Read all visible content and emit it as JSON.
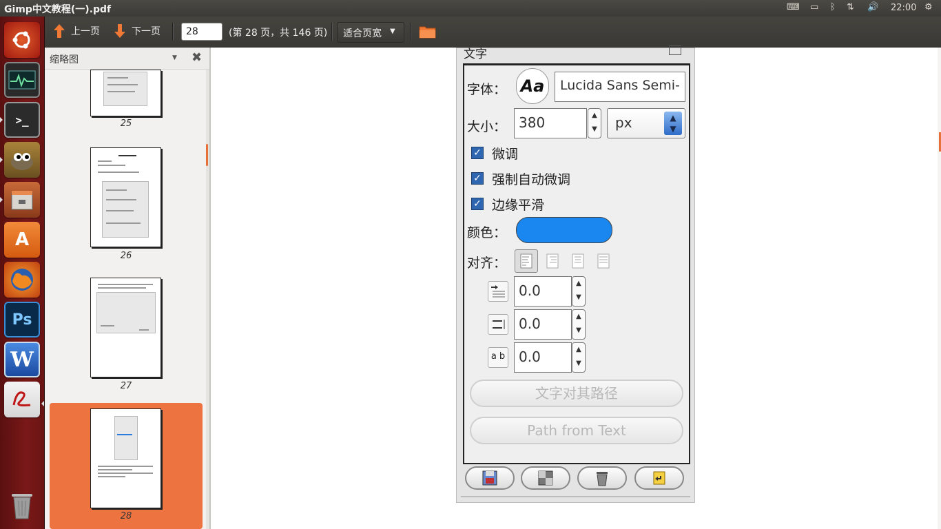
{
  "top_panel": {
    "title": "Gimp中文教程(一).pdf",
    "clock": "22:00"
  },
  "launcher": {
    "items": [
      "ubuntu-home",
      "system-monitor",
      "terminal",
      "gimp",
      "file-manager",
      "software-center",
      "firefox",
      "photoshop",
      "wps-writer",
      "pdf-reader",
      "trash"
    ]
  },
  "toolbar": {
    "prev_label": "上一页",
    "next_label": "下一页",
    "page_value": "28",
    "page_count": "(第 28 页，共 146 页)",
    "zoom_label": "适合页宽"
  },
  "sidebar": {
    "title": "缩略图",
    "thumbnails": [
      {
        "label": "25"
      },
      {
        "label": "26"
      },
      {
        "label": "27"
      },
      {
        "label": "28"
      }
    ]
  },
  "gimp": {
    "panel_title": "文字",
    "font_label": "字体：",
    "font_preview": "Aa",
    "font_value": "Lucida Sans Semi-",
    "size_label": "大小：",
    "size_value": "380",
    "unit_value": "px",
    "hinting_label": "微调",
    "force_autohint_label": "强制自动微调",
    "antialias_label": "边缘平滑",
    "color_label": "颜色：",
    "color_value": "#1a87f0",
    "justify_label": "对齐：",
    "indent_value": "0.0",
    "line_spacing_value": "0.0",
    "letter_spacing_value": "0.0",
    "letter_spacing_icon": "a b",
    "text_along_path_label": "文字对其路径",
    "path_from_text_label": "Path from Text"
  }
}
